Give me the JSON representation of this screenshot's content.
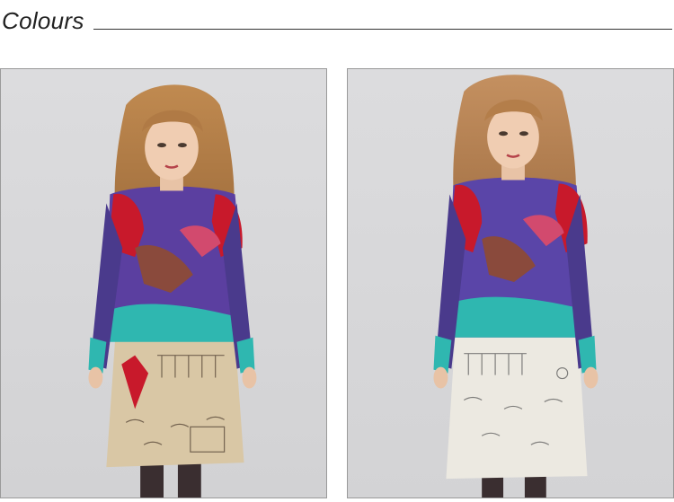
{
  "section": {
    "title": "Colours"
  },
  "photos": [
    {
      "variant": "beige",
      "background": "#d8d8da",
      "dress_lower": "#d9c7a5",
      "accent": "#c8192b"
    },
    {
      "variant": "white",
      "background": "#d9d9db",
      "dress_lower": "#ece9e1",
      "accent": "#c8192b"
    }
  ]
}
